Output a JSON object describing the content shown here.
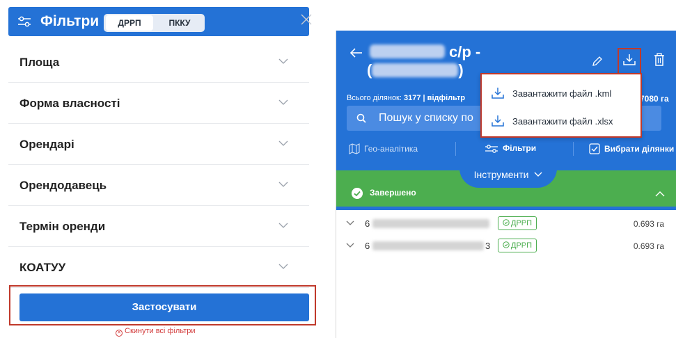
{
  "left": {
    "title": "Фільтри",
    "segments": [
      {
        "label": "ДРРП",
        "active": true
      },
      {
        "label": "ПККУ",
        "active": false
      }
    ],
    "filters": [
      "Площа",
      "Форма власності",
      "Орендарі",
      "Орендодавець",
      "Термін оренди",
      "КОАТУУ"
    ],
    "apply_label": "Застосувати",
    "reset_label": "Скинути всі фільтри"
  },
  "right": {
    "title_suffix": "с/р -",
    "title_line2_open": "(",
    "title_line2_close": ")",
    "stats": {
      "total_label": "Всього ділянок:",
      "total_value": "3177",
      "filtered_label": "| відфільтр",
      "area_value": "7080 га"
    },
    "search_placeholder": "Пошук у списку по",
    "tools": [
      "Гео-аналітика",
      "Фільтри",
      "Вибрати ділянки"
    ],
    "tools_tab_label": "Інструменти",
    "status_label": "Завершено",
    "rows": [
      {
        "num_start": "6",
        "num_end": "",
        "badge": "ДРРП",
        "area": "0.693 га"
      },
      {
        "num_start": "6",
        "num_end": "3",
        "badge": "ДРРП",
        "area": "0.693 га"
      }
    ],
    "dropdown": [
      "Завантажити файл .kml",
      "Завантажити файл .xlsx"
    ]
  },
  "colors": {
    "primary_blue": "#2472d6",
    "success_green": "#4cae4f",
    "highlight_red": "#c0392b",
    "danger_red": "#d23b3b"
  }
}
